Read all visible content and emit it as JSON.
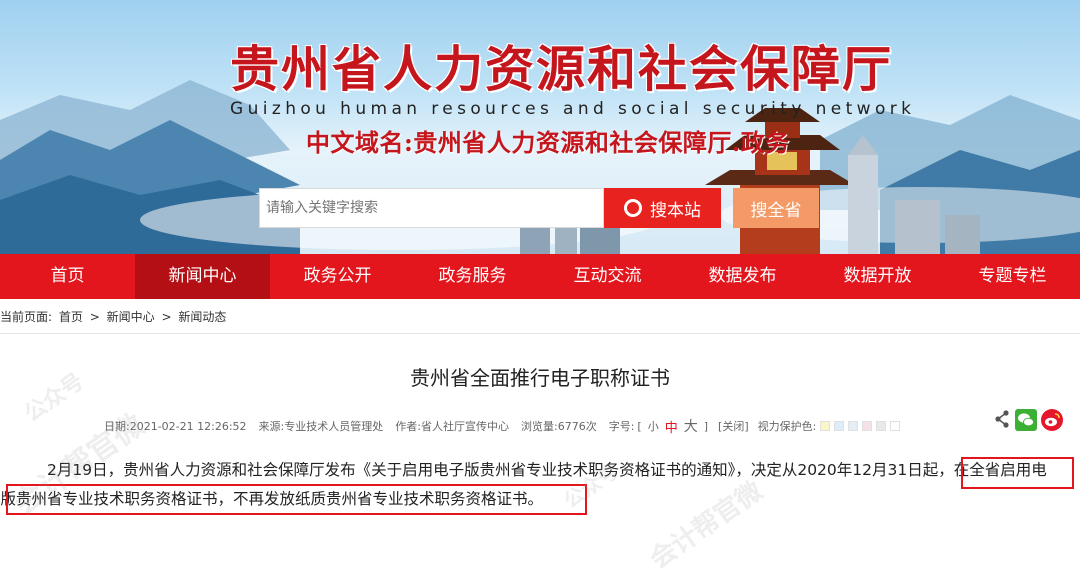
{
  "header": {
    "title": "贵州省人力资源和社会保障厅",
    "subtitle": "Guizhou human resources and social security network",
    "domain_name": "中文域名:贵州省人力资源和社会保障厅.政务",
    "pavilion_plaque": "甲秀楼"
  },
  "search": {
    "placeholder": "请输入关键字搜索",
    "site_button": "搜本站",
    "province_button": "搜全省"
  },
  "nav": {
    "items": [
      "首页",
      "新闻中心",
      "政务公开",
      "政务服务",
      "互动交流",
      "数据发布",
      "数据开放",
      "专题专栏"
    ],
    "active_index": 1
  },
  "breadcrumb": {
    "prefix": "当前页面:",
    "items": [
      "首页",
      "新闻中心",
      "新闻动态"
    ],
    "separator": ">"
  },
  "article": {
    "title": "贵州省全面推行电子职称证书",
    "meta": {
      "date_label": "日期:",
      "date": "2021-02-21 12:26:52",
      "source_label": "来源:",
      "source": "专业技术人员管理处",
      "author_label": "作者:",
      "author": "省人社厅宣传中心",
      "views_label": "浏览量:",
      "views": "6776次",
      "font_label": "字号:",
      "font_open": "[",
      "font_small": "小",
      "font_medium": "中",
      "font_large": "大",
      "font_close": "]",
      "close_label": "[关闭]",
      "eye_label": "视力保护色:",
      "eye_colors": [
        "#fbf6c7",
        "#dceefc",
        "#e3eef7",
        "#f5e1e8",
        "#e9e9ec",
        "#ffffff"
      ]
    },
    "body_line1": "2月19日，贵州省人力资源和社会保障厅发布《关于启用电子版贵州省专业技术职务资格证书的通知》，决定从2020年12月31日起，",
    "body_highlight_a": "在全省启用电",
    "body_highlight_b": "子版贵州省专业技术职务资格证书，不再发放纸质贵州省专业技术职务资格证书。"
  },
  "watermark": {
    "text_a": "公众号",
    "text_b": "会计帮官微"
  },
  "colors": {
    "brand_red": "#e3161e",
    "nav_active": "#b40f15",
    "search_orange": "#f39a66",
    "wechat_green": "#3cb034",
    "weibo_red": "#e6162d"
  }
}
